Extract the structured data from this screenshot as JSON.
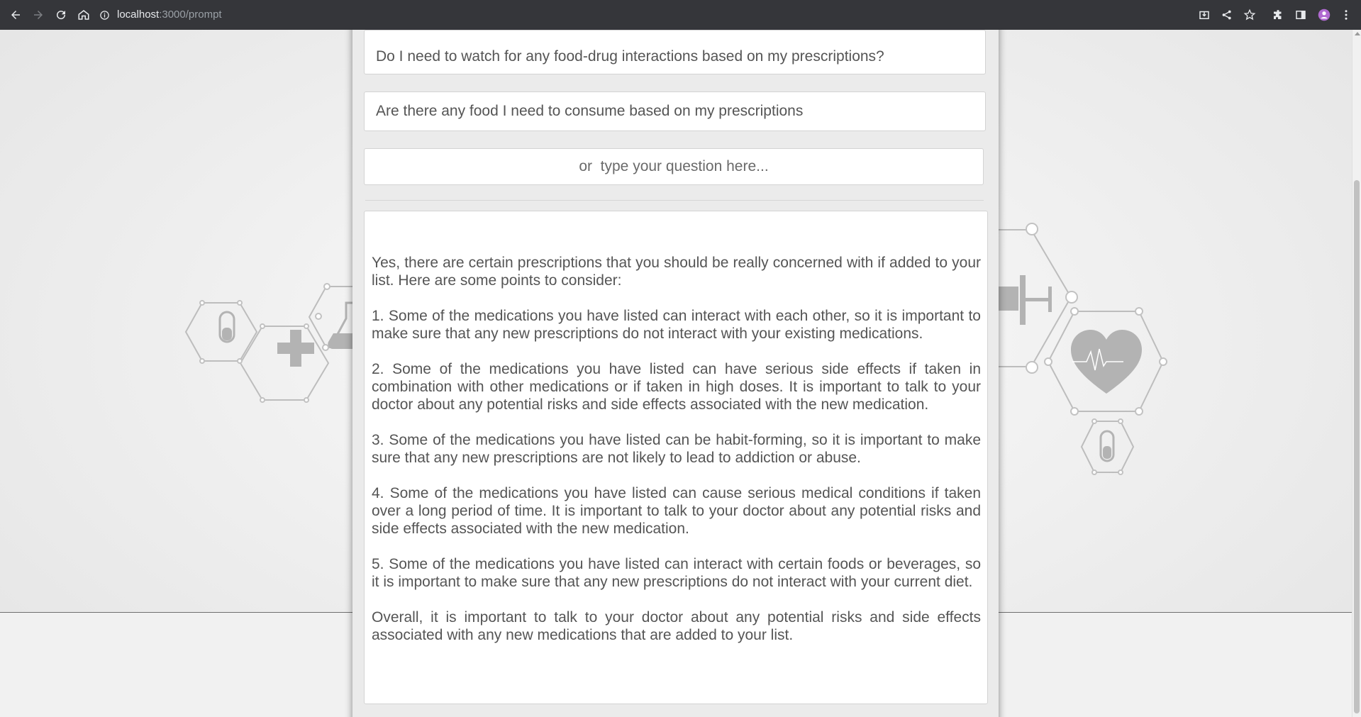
{
  "browser": {
    "url_host": "localhost",
    "url_path": ":3000/prompt",
    "icons": [
      "back-arrow-icon",
      "forward-arrow-icon",
      "reload-icon",
      "home-icon",
      "info-icon",
      "install-icon",
      "share-icon",
      "star-icon",
      "extensions-icon",
      "side-panel-icon",
      "profile-avatar",
      "more-menu-icon"
    ]
  },
  "suggestions": [
    "Do I need to watch for any food-drug interactions based on my prescriptions?",
    "Are there any food I need to consume based on my prescriptions"
  ],
  "question": {
    "placeholder": "or  type your question here..."
  },
  "response": {
    "paragraphs": [
      "Yes, there are certain prescriptions that you should be really concerned with if added to your list. Here are some points to consider:",
      "1. Some of the medications you have listed can interact with each other, so it is important to make sure that any new prescriptions do not interact with your existing medications.",
      "2. Some of the medications you have listed can have serious side effects if taken in combination with other medications or if taken in high doses. It is important to talk to your doctor about any potential risks and side effects associated with the new medication.",
      "3. Some of the medications you have listed can be habit-forming, so it is important to make sure that any new prescriptions are not likely to lead to addiction or abuse.",
      "4. Some of the medications you have listed can cause serious medical conditions if taken over a long period of time. It is important to talk to your doctor about any potential risks and side effects associated with the new medication.",
      "5. Some of the medications you have listed can interact with certain foods or beverages, so it is important to make sure that any new prescriptions do not interact with your current diet.",
      "Overall, it is important to talk to your doctor about any potential risks and side effects associated with any new medications that are added to your list."
    ]
  },
  "colors": {
    "chrome": "#35363a",
    "card": "#ebebeb",
    "text": "#555555",
    "art": "#bdbdbd"
  }
}
